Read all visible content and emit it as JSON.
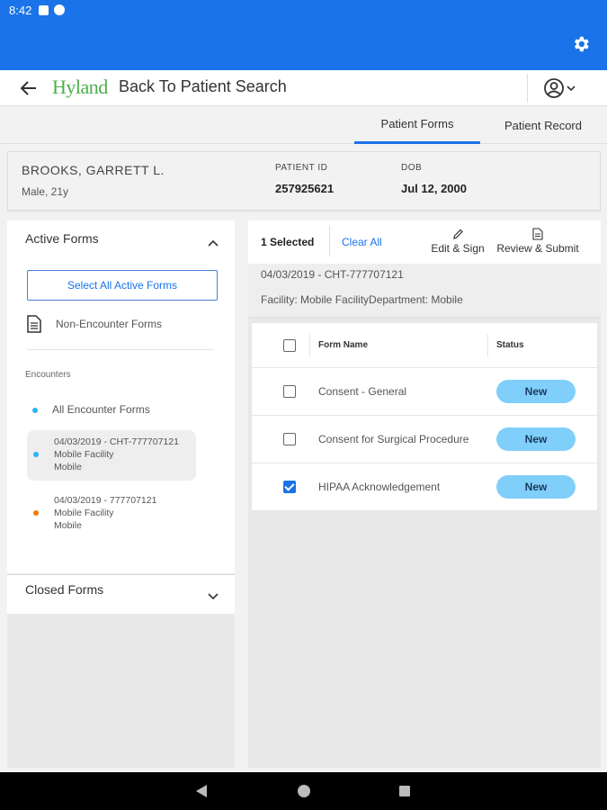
{
  "statusbar": {
    "time": "8:42"
  },
  "nav": {
    "logo": "Hyland",
    "title": "Back To Patient Search"
  },
  "tabs": [
    {
      "label": "Patient Forms",
      "active": true
    },
    {
      "label": "Patient Record",
      "active": false
    }
  ],
  "patient": {
    "name": "BROOKS, GARRETT L.",
    "sub": "Male, 21y",
    "id_label": "PATIENT ID",
    "id_value": "257925621",
    "dob_label": "DOB",
    "dob_value": "Jul 12, 2000"
  },
  "left": {
    "active_title": "Active Forms",
    "select_all": "Select All Active Forms",
    "non_encounter": "Non-Encounter Forms",
    "encounters_label": "Encounters",
    "all_encounter": "All Encounter Forms",
    "encounters": [
      {
        "line1": "04/03/2019 - CHT-777707121",
        "line2": "Mobile Facility",
        "line3": "Mobile",
        "color": "#29b6f6"
      },
      {
        "line1": "04/03/2019 - 777707121",
        "line2": "Mobile Facility",
        "line3": "Mobile",
        "color": "#f57c00"
      }
    ],
    "closed_title": "Closed Forms"
  },
  "toolbar": {
    "selected": "1 Selected",
    "clear": "Clear All",
    "edit": "Edit & Sign",
    "review": "Review & Submit"
  },
  "encounter_info": {
    "line1": "04/03/2019 - CHT-777707121",
    "line2": "Facility: Mobile FacilityDepartment: Mobile"
  },
  "table": {
    "col_name": "Form Name",
    "col_status": "Status",
    "rows": [
      {
        "name": "Consent - General",
        "status": "New",
        "checked": false
      },
      {
        "name": "Consent for Surgical Procedure",
        "status": "New",
        "checked": false
      },
      {
        "name": "HIPAA Acknowledgement",
        "status": "New",
        "checked": true
      }
    ]
  },
  "colors": {
    "primary": "#1a73e8",
    "badge": "#80cffb",
    "logo": "#4caf50"
  }
}
